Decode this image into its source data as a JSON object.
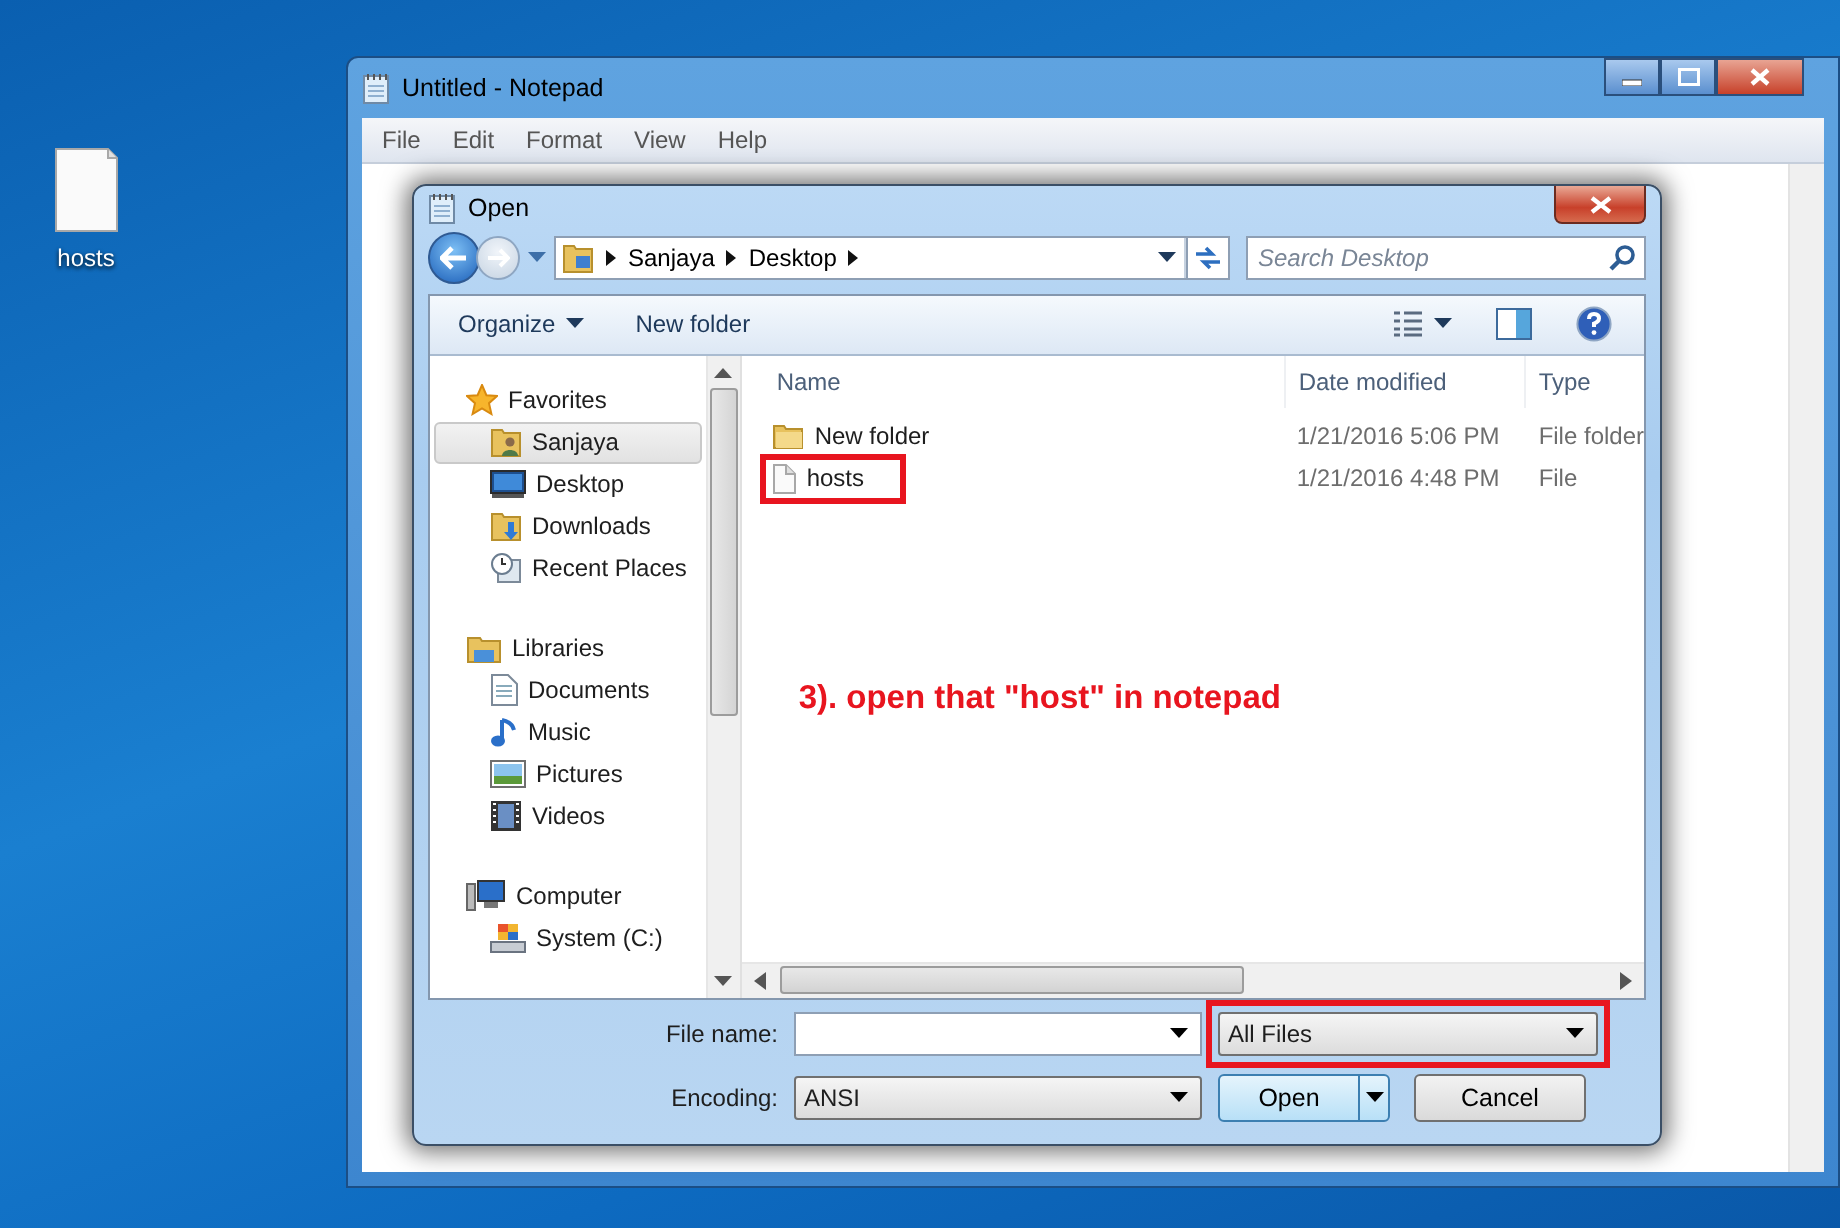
{
  "desktop": {
    "icons": [
      {
        "label": "hosts"
      }
    ]
  },
  "notepad": {
    "title": "Untitled - Notepad",
    "menu": [
      "File",
      "Edit",
      "Format",
      "View",
      "Help"
    ]
  },
  "dialog": {
    "title": "Open",
    "breadcrumb": [
      "Sanjaya",
      "Desktop"
    ],
    "search": {
      "placeholder": "Search Desktop"
    },
    "toolbar": {
      "organize": "Organize",
      "new_folder": "New folder"
    },
    "navigation": [
      {
        "label": "Favorites",
        "kind": "star",
        "selected": false,
        "children": [
          {
            "label": "Sanjaya",
            "kind": "user",
            "selected": true
          },
          {
            "label": "Desktop",
            "kind": "desktop",
            "selected": false
          },
          {
            "label": "Downloads",
            "kind": "downloads",
            "selected": false
          },
          {
            "label": "Recent Places",
            "kind": "recent",
            "selected": false
          }
        ]
      },
      {
        "label": "Libraries",
        "kind": "libraries",
        "selected": false,
        "children": [
          {
            "label": "Documents",
            "kind": "documents",
            "selected": false
          },
          {
            "label": "Music",
            "kind": "music",
            "selected": false
          },
          {
            "label": "Pictures",
            "kind": "pictures",
            "selected": false
          },
          {
            "label": "Videos",
            "kind": "videos",
            "selected": false
          }
        ]
      },
      {
        "label": "Computer",
        "kind": "computer",
        "selected": false,
        "children": [
          {
            "label": "System (C:)",
            "kind": "drive",
            "selected": false
          }
        ]
      }
    ],
    "columns": [
      "Name",
      "Date modified",
      "Type"
    ],
    "files": [
      {
        "name": "New folder",
        "kind": "folder",
        "date": "1/21/2016 5:06 PM",
        "type": "File folder",
        "highlighted": false
      },
      {
        "name": "hosts",
        "kind": "file",
        "date": "1/21/2016 4:48 PM",
        "type": "File",
        "highlighted": true
      }
    ],
    "annotation": "3). open that \"host\" in notepad",
    "file_name_label": "File name:",
    "file_type": {
      "value": "All Files",
      "highlighted": true
    },
    "encoding": {
      "label": "Encoding:",
      "value": "ANSI"
    },
    "buttons": [
      {
        "label": "Open",
        "kind": "split"
      },
      {
        "label": "Cancel",
        "kind": "plain"
      }
    ]
  }
}
